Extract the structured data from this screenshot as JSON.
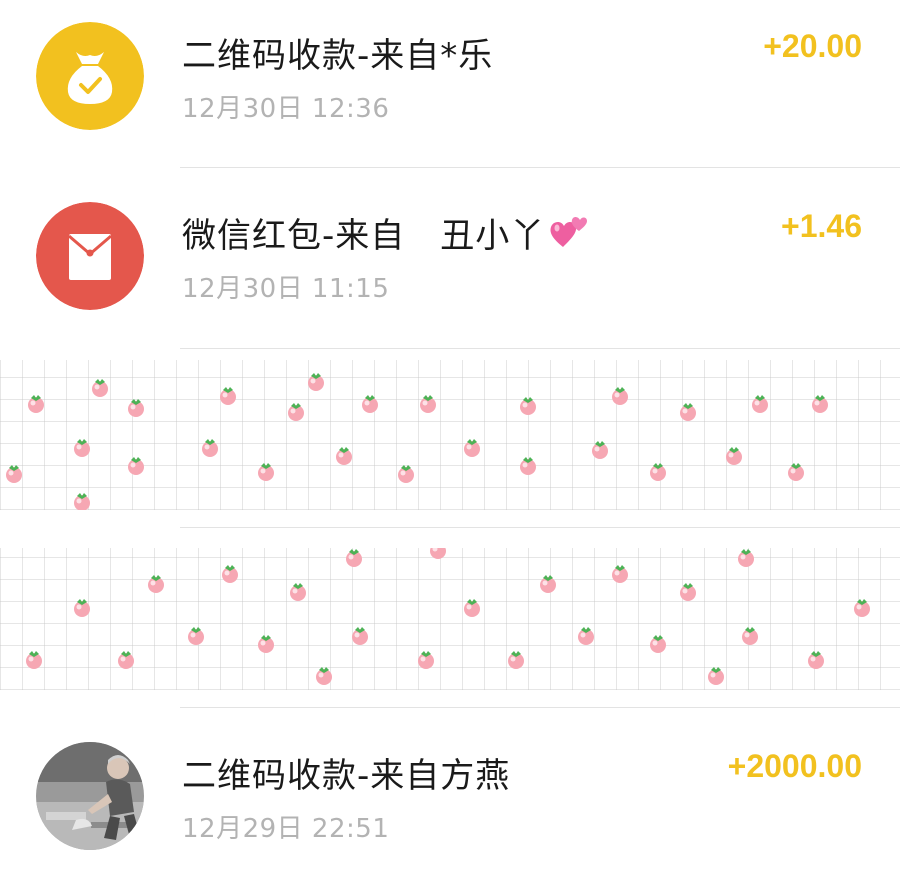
{
  "transactions": [
    {
      "title": "二维码收款-来自*乐",
      "time": "12月30日 12:36",
      "amount": "+20.00",
      "icon": "money-bag-icon"
    },
    {
      "title": "微信红包-来自　丑小丫",
      "time": "12月30日 11:15",
      "amount": "+1.46",
      "icon": "red-packet-icon",
      "emoji": "two-hearts-icon"
    },
    {
      "title": "二维码收款-来自方燕",
      "time": "12月29日 22:51",
      "amount": "+2000.00",
      "icon": "user-photo-avatar"
    }
  ],
  "colors": {
    "amount": "#f2c11f",
    "money_bag_bg": "#f2c11f",
    "red_packet_bg": "#e4574c",
    "title": "#1a1a1a",
    "time": "#b3b3b3",
    "divider": "#e3e3e3"
  }
}
